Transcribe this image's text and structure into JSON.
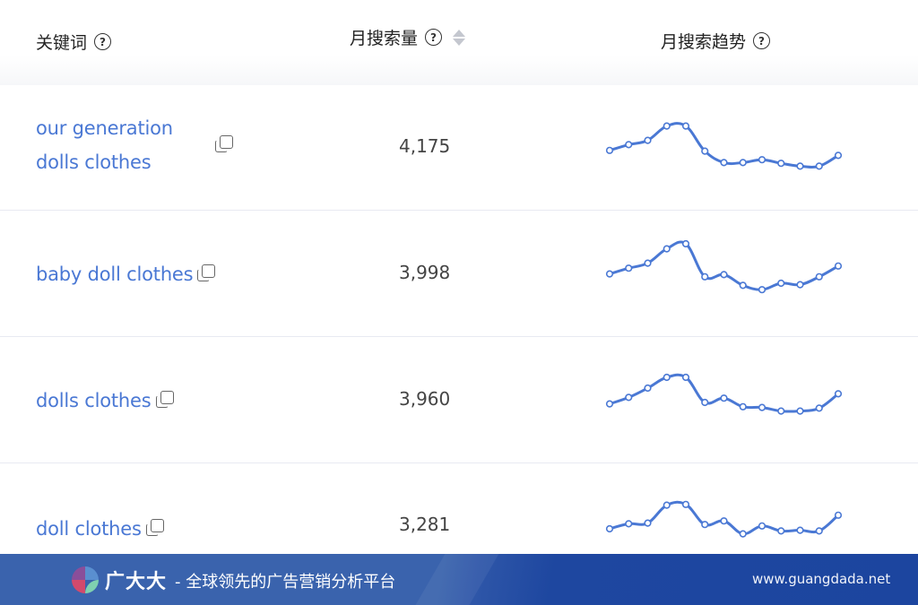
{
  "header": {
    "keyword_label": "关键词",
    "volume_label": "月搜索量",
    "trend_label": "月搜索趋势",
    "help_glyph": "?"
  },
  "colors": {
    "link": "#4a78d4",
    "sparkline": "#4a78d4",
    "footer_bg": "#1f48a0"
  },
  "rows": [
    {
      "keyword_lines": [
        "our generation",
        "dolls clothes"
      ],
      "volume": "4,175",
      "trend": [
        34,
        42,
        48,
        68,
        68,
        33,
        17,
        17,
        21,
        16,
        12,
        12,
        27
      ]
    },
    {
      "keyword_lines": [
        "baby doll clothes"
      ],
      "volume": "3,998",
      "trend": [
        38,
        46,
        53,
        73,
        80,
        34,
        37,
        22,
        16,
        25,
        23,
        34,
        49
      ]
    },
    {
      "keyword_lines": [
        "dolls clothes"
      ],
      "volume": "3,960",
      "trend": [
        33,
        42,
        55,
        70,
        70,
        35,
        41,
        29,
        28,
        23,
        23,
        27,
        47
      ]
    },
    {
      "keyword_lines": [
        "doll clothes"
      ],
      "volume": "3,281",
      "trend": [
        35,
        42,
        43,
        68,
        69,
        41,
        46,
        28,
        39,
        32,
        33,
        32,
        54
      ]
    }
  ],
  "footer": {
    "brand": "广大大",
    "tagline": "- 全球领先的广告营销分析平台",
    "website": "www.guangdada.net"
  }
}
